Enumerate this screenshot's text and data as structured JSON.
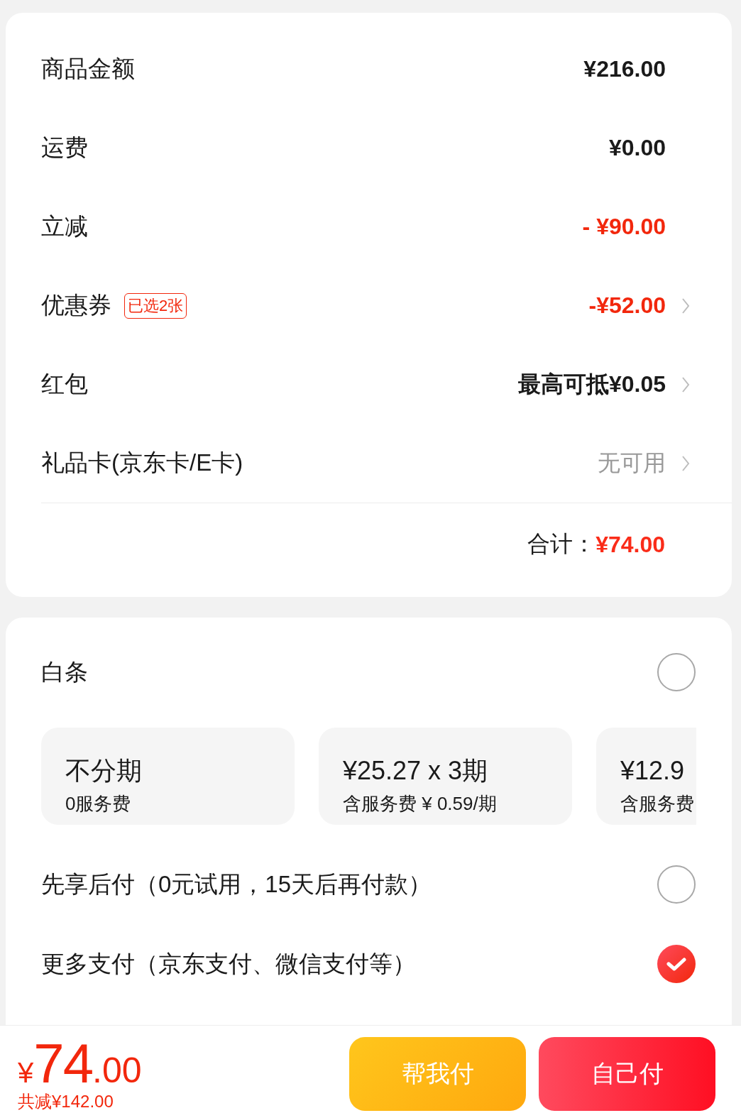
{
  "summary": {
    "rows": [
      {
        "label": "商品金额",
        "value": "¥216.00",
        "kind": "normal",
        "chevron": false
      },
      {
        "label": "运费",
        "value": "¥0.00",
        "kind": "normal",
        "chevron": false
      },
      {
        "label": "立减",
        "value": "- ¥90.00",
        "kind": "discount",
        "chevron": false
      },
      {
        "label": "优惠券",
        "tag": "已选2张",
        "value": "-¥52.00",
        "kind": "discount",
        "chevron": true
      },
      {
        "label": "红包",
        "value": "最高可抵¥0.05",
        "kind": "normal",
        "chevron": true
      },
      {
        "label": "礼品卡(京东卡/E卡)",
        "value": "无可用",
        "kind": "muted",
        "chevron": true
      }
    ],
    "total": {
      "label": "合计：",
      "value": "¥74.00"
    }
  },
  "payment": {
    "methods": [
      {
        "label": "白条",
        "selected": false,
        "installments": [
          {
            "title": "不分期",
            "note": "0服务费",
            "selected": false
          },
          {
            "title": "¥25.27 x 3期",
            "note": "含服务费 ¥ 0.59/期",
            "selected": false
          },
          {
            "title": "¥12.9",
            "note": "含服务费",
            "selected": false
          }
        ]
      },
      {
        "label": "先享后付（0元试用，15天后再付款）",
        "selected": false
      },
      {
        "label": "更多支付（京东支付、微信支付等）",
        "selected": true
      }
    ]
  },
  "bottom_bar": {
    "price": {
      "currency": "¥",
      "integer": "74",
      "decimal": ".00"
    },
    "saving": "共减¥142.00",
    "buttons": [
      {
        "label": "帮我付",
        "kind": "secondary"
      },
      {
        "label": "自己付",
        "kind": "primary"
      }
    ]
  }
}
